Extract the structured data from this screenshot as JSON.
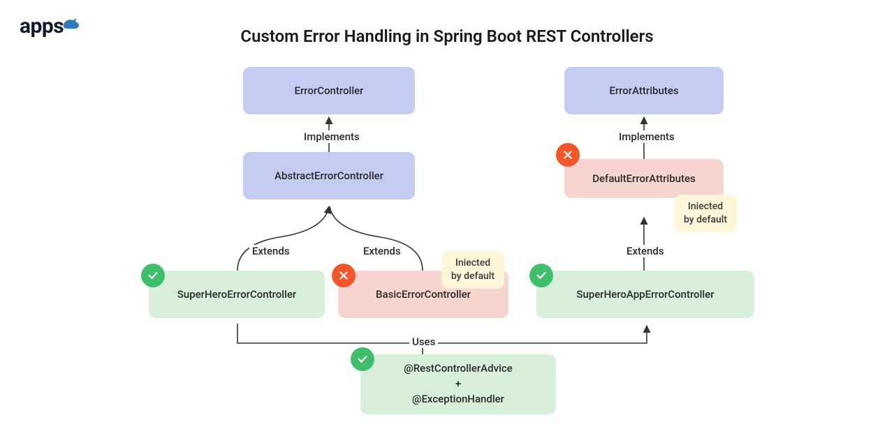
{
  "logo_text": "apps",
  "title": "Custom Error Handling in Spring Boot REST Controllers",
  "boxes": {
    "errorController": "ErrorController",
    "abstractErrorController": "AbstractErrorController",
    "superHeroErrorController": "SuperHeroErrorController",
    "basicErrorController": "BasicErrorController",
    "errorAttributes": "ErrorAttributes",
    "defaultErrorAttributes": "DefaultErrorAttributes",
    "superHeroAppErrorController": "SuperHeroAppErrorController",
    "advice": "@RestControllerAdvice\n+\n@ExceptionHandler"
  },
  "labels": {
    "implements1": "Implements",
    "implements2": "Implements",
    "extends1": "Extends",
    "extends2": "Extends",
    "extends3": "Extends",
    "uses": "Uses"
  },
  "notes": {
    "injected1": "Iniected\nby default",
    "injected2": "Iniected\nby default"
  },
  "colors": {
    "purple": "#c6cbf2",
    "green": "#d8efdc",
    "red": "#f6d4cf",
    "badge_ok": "#3fbf6b",
    "badge_no": "#f1572a",
    "note_bg": "#fdf6d9"
  }
}
